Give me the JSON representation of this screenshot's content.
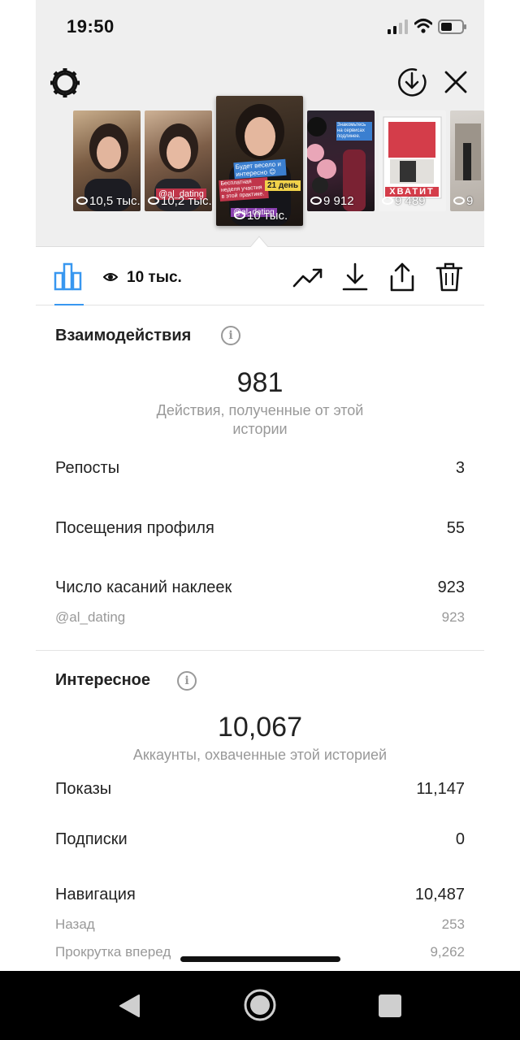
{
  "status_bar": {
    "time": "19:50"
  },
  "stories": [
    {
      "views": "10,5 тыс.",
      "active": false
    },
    {
      "views": "10,2 тыс.",
      "active": false,
      "sticker": "@al_dating"
    },
    {
      "views": "10 тыс.",
      "active": true,
      "captions": [
        "Будет весело и интересно 😊",
        "Бесплатная неделя участия в этой практике.",
        "21 день",
        "@al_dating"
      ]
    },
    {
      "views": "9 912",
      "active": false,
      "caption": "Знакомьтесь на сервисах подлинее."
    },
    {
      "views": "9 489",
      "active": false,
      "caption": "ХВАТИТ"
    },
    {
      "views": "9",
      "active": false
    }
  ],
  "toolbar": {
    "views": "10 тыс."
  },
  "interactions": {
    "title": "Взаимодействия",
    "total": "981",
    "caption": "Действия, полученные от этой истории",
    "rows": [
      {
        "label": "Репосты",
        "value": "3"
      },
      {
        "label": "Посещения профиля",
        "value": "55"
      },
      {
        "label": "Число касаний наклеек",
        "value": "923"
      }
    ],
    "sub_rows": [
      {
        "label": "@al_dating",
        "value": "923"
      }
    ]
  },
  "discovery": {
    "title": "Интересное",
    "total": "10,067",
    "caption": "Аккаунты, охваченные этой историей",
    "rows": [
      {
        "label": "Показы",
        "value": "11,147"
      },
      {
        "label": "Подписки",
        "value": "0"
      },
      {
        "label": "Навигация",
        "value": "10,487"
      }
    ],
    "sub_rows": [
      {
        "label": "Назад",
        "value": "253"
      },
      {
        "label": "Прокрутка вперед",
        "value": "9,262"
      }
    ]
  },
  "colors": {
    "accent": "#3897f0",
    "text": "#222222",
    "muted": "#999999",
    "header_bg": "#efefef"
  }
}
